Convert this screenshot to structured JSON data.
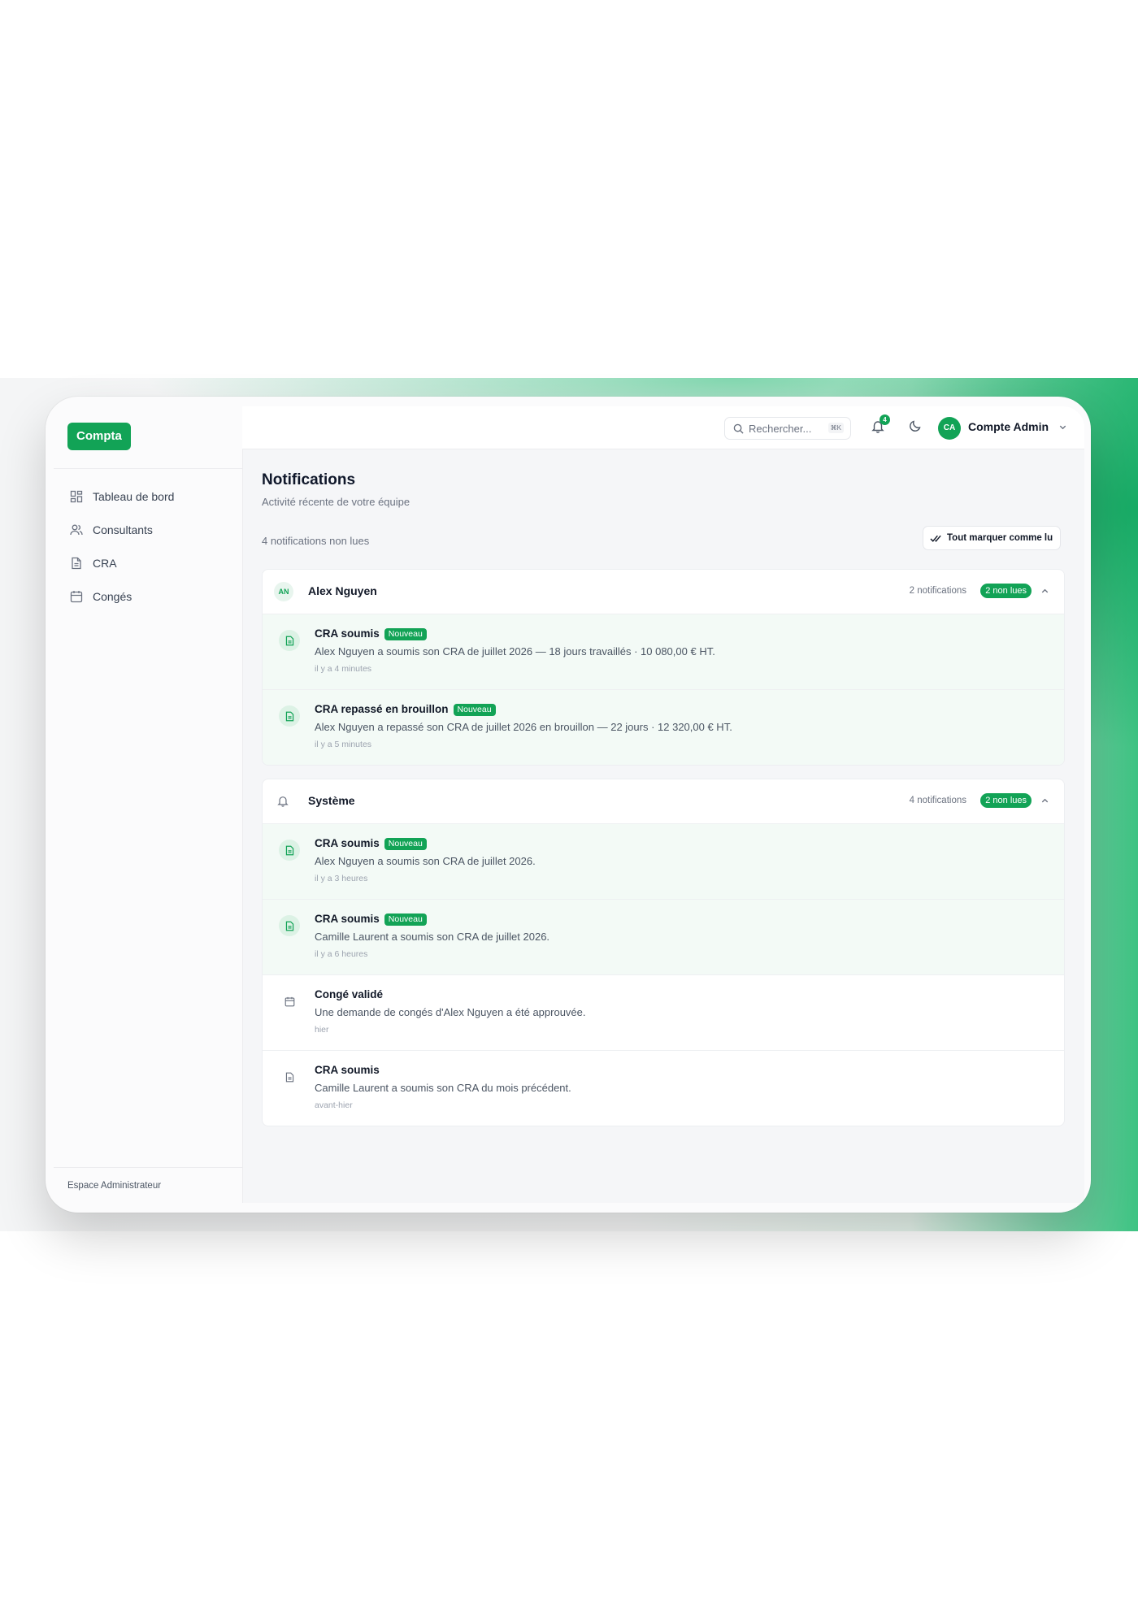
{
  "brand": "Compta",
  "sidebar": {
    "items": [
      {
        "label": "Tableau de bord",
        "icon": "dashboard-icon"
      },
      {
        "label": "Consultants",
        "icon": "users-icon"
      },
      {
        "label": "CRA",
        "icon": "file-icon"
      },
      {
        "label": "Congés",
        "icon": "calendar-icon"
      }
    ],
    "footer": "Espace Administrateur"
  },
  "topbar": {
    "search_placeholder": "Rechercher...",
    "search_shortcut": "⌘K",
    "notifications_badge": "4",
    "avatar_initials": "CA",
    "account_name": "Compte Admin"
  },
  "page": {
    "title": "Notifications",
    "subtitle": "Activité récente de votre équipe",
    "unread_summary": "4 notifications non lues",
    "mark_all_label": "Tout marquer comme lu"
  },
  "groups": [
    {
      "initials": "AN",
      "title": "Alex Nguyen",
      "count": "2 notifications",
      "badge": "2 non lues",
      "items": [
        {
          "title": "CRA soumis",
          "new": "Nouveau",
          "desc": "Alex Nguyen a soumis son CRA de juillet 2026 — 18 jours travaillés · 10 080,00 € HT.",
          "time": "il y a 4 minutes"
        },
        {
          "title": "CRA repassé en brouillon",
          "new": "Nouveau",
          "desc": "Alex Nguyen a repassé son CRA de juillet 2026 en brouillon — 22 jours · 12 320,00 € HT.",
          "time": "il y a 5 minutes"
        }
      ]
    },
    {
      "title": "Système",
      "count": "4 notifications",
      "badge": "2 non lues",
      "items": [
        {
          "title": "CRA soumis",
          "new": "Nouveau",
          "desc": "Alex Nguyen a soumis son CRA de juillet 2026.",
          "time": "il y a 3 heures"
        },
        {
          "title": "CRA soumis",
          "new": "Nouveau",
          "desc": "Camille Laurent a soumis son CRA de juillet 2026.",
          "time": "il y a 6 heures"
        },
        {
          "title": "Congé validé",
          "desc": "Une demande de congés d'Alex Nguyen a été approuvée.",
          "time": "hier"
        },
        {
          "title": "CRA soumis",
          "desc": "Camille Laurent a soumis son CRA du mois précédent.",
          "time": "avant-hier"
        }
      ]
    }
  ],
  "colors": {
    "accent": "#12a356",
    "unread_bg": "#f3faf6"
  }
}
